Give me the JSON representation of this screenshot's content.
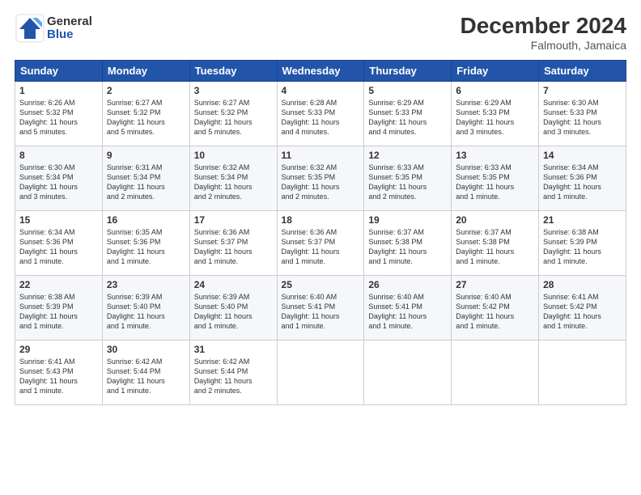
{
  "logo": {
    "general": "General",
    "blue": "Blue"
  },
  "header": {
    "month_year": "December 2024",
    "location": "Falmouth, Jamaica"
  },
  "days_of_week": [
    "Sunday",
    "Monday",
    "Tuesday",
    "Wednesday",
    "Thursday",
    "Friday",
    "Saturday"
  ],
  "weeks": [
    [
      {
        "day": "1",
        "text": "Sunrise: 6:26 AM\nSunset: 5:32 PM\nDaylight: 11 hours\nand 5 minutes."
      },
      {
        "day": "2",
        "text": "Sunrise: 6:27 AM\nSunset: 5:32 PM\nDaylight: 11 hours\nand 5 minutes."
      },
      {
        "day": "3",
        "text": "Sunrise: 6:27 AM\nSunset: 5:32 PM\nDaylight: 11 hours\nand 5 minutes."
      },
      {
        "day": "4",
        "text": "Sunrise: 6:28 AM\nSunset: 5:33 PM\nDaylight: 11 hours\nand 4 minutes."
      },
      {
        "day": "5",
        "text": "Sunrise: 6:29 AM\nSunset: 5:33 PM\nDaylight: 11 hours\nand 4 minutes."
      },
      {
        "day": "6",
        "text": "Sunrise: 6:29 AM\nSunset: 5:33 PM\nDaylight: 11 hours\nand 3 minutes."
      },
      {
        "day": "7",
        "text": "Sunrise: 6:30 AM\nSunset: 5:33 PM\nDaylight: 11 hours\nand 3 minutes."
      }
    ],
    [
      {
        "day": "8",
        "text": "Sunrise: 6:30 AM\nSunset: 5:34 PM\nDaylight: 11 hours\nand 3 minutes."
      },
      {
        "day": "9",
        "text": "Sunrise: 6:31 AM\nSunset: 5:34 PM\nDaylight: 11 hours\nand 2 minutes."
      },
      {
        "day": "10",
        "text": "Sunrise: 6:32 AM\nSunset: 5:34 PM\nDaylight: 11 hours\nand 2 minutes."
      },
      {
        "day": "11",
        "text": "Sunrise: 6:32 AM\nSunset: 5:35 PM\nDaylight: 11 hours\nand 2 minutes."
      },
      {
        "day": "12",
        "text": "Sunrise: 6:33 AM\nSunset: 5:35 PM\nDaylight: 11 hours\nand 2 minutes."
      },
      {
        "day": "13",
        "text": "Sunrise: 6:33 AM\nSunset: 5:35 PM\nDaylight: 11 hours\nand 1 minute."
      },
      {
        "day": "14",
        "text": "Sunrise: 6:34 AM\nSunset: 5:36 PM\nDaylight: 11 hours\nand 1 minute."
      }
    ],
    [
      {
        "day": "15",
        "text": "Sunrise: 6:34 AM\nSunset: 5:36 PM\nDaylight: 11 hours\nand 1 minute."
      },
      {
        "day": "16",
        "text": "Sunrise: 6:35 AM\nSunset: 5:36 PM\nDaylight: 11 hours\nand 1 minute."
      },
      {
        "day": "17",
        "text": "Sunrise: 6:36 AM\nSunset: 5:37 PM\nDaylight: 11 hours\nand 1 minute."
      },
      {
        "day": "18",
        "text": "Sunrise: 6:36 AM\nSunset: 5:37 PM\nDaylight: 11 hours\nand 1 minute."
      },
      {
        "day": "19",
        "text": "Sunrise: 6:37 AM\nSunset: 5:38 PM\nDaylight: 11 hours\nand 1 minute."
      },
      {
        "day": "20",
        "text": "Sunrise: 6:37 AM\nSunset: 5:38 PM\nDaylight: 11 hours\nand 1 minute."
      },
      {
        "day": "21",
        "text": "Sunrise: 6:38 AM\nSunset: 5:39 PM\nDaylight: 11 hours\nand 1 minute."
      }
    ],
    [
      {
        "day": "22",
        "text": "Sunrise: 6:38 AM\nSunset: 5:39 PM\nDaylight: 11 hours\nand 1 minute."
      },
      {
        "day": "23",
        "text": "Sunrise: 6:39 AM\nSunset: 5:40 PM\nDaylight: 11 hours\nand 1 minute."
      },
      {
        "day": "24",
        "text": "Sunrise: 6:39 AM\nSunset: 5:40 PM\nDaylight: 11 hours\nand 1 minute."
      },
      {
        "day": "25",
        "text": "Sunrise: 6:40 AM\nSunset: 5:41 PM\nDaylight: 11 hours\nand 1 minute."
      },
      {
        "day": "26",
        "text": "Sunrise: 6:40 AM\nSunset: 5:41 PM\nDaylight: 11 hours\nand 1 minute."
      },
      {
        "day": "27",
        "text": "Sunrise: 6:40 AM\nSunset: 5:42 PM\nDaylight: 11 hours\nand 1 minute."
      },
      {
        "day": "28",
        "text": "Sunrise: 6:41 AM\nSunset: 5:42 PM\nDaylight: 11 hours\nand 1 minute."
      }
    ],
    [
      {
        "day": "29",
        "text": "Sunrise: 6:41 AM\nSunset: 5:43 PM\nDaylight: 11 hours\nand 1 minute."
      },
      {
        "day": "30",
        "text": "Sunrise: 6:42 AM\nSunset: 5:44 PM\nDaylight: 11 hours\nand 1 minute."
      },
      {
        "day": "31",
        "text": "Sunrise: 6:42 AM\nSunset: 5:44 PM\nDaylight: 11 hours\nand 2 minutes."
      },
      {
        "day": "",
        "text": ""
      },
      {
        "day": "",
        "text": ""
      },
      {
        "day": "",
        "text": ""
      },
      {
        "day": "",
        "text": ""
      }
    ]
  ]
}
